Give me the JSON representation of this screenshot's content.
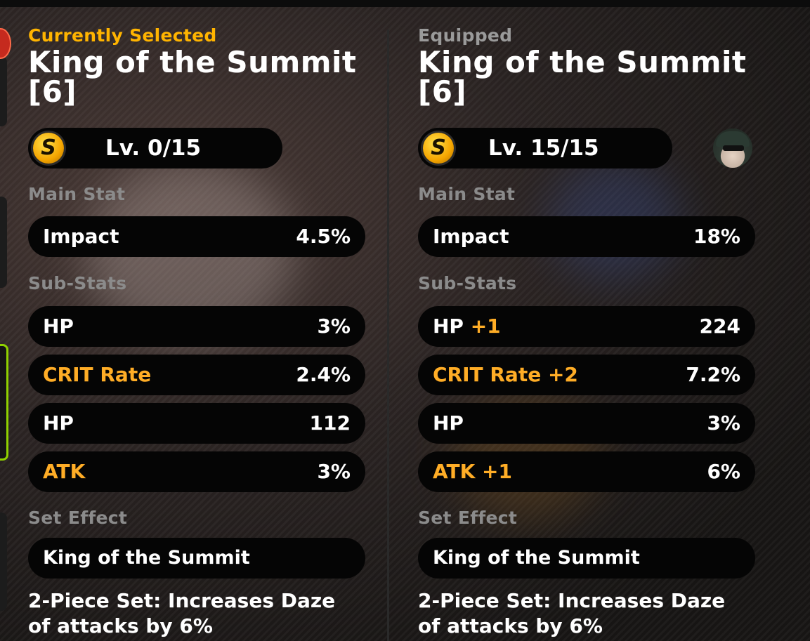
{
  "current": {
    "header": "Currently Selected",
    "name_line1": "King of the Summit",
    "name_line2": "[6]",
    "level": "Lv. 0/15",
    "rank_icon": "S",
    "main_stat_title": "Main Stat",
    "main_stat": {
      "name": "Impact",
      "value": "4.5%"
    },
    "sub_stats_title": "Sub-Stats",
    "sub_stats": [
      {
        "name": "HP",
        "boost": "",
        "value": "3%"
      },
      {
        "name": "CRIT Rate",
        "boost": "",
        "value": "2.4%"
      },
      {
        "name": "HP",
        "boost": "",
        "value": "112"
      },
      {
        "name": "ATK",
        "boost": "",
        "value": "3%"
      }
    ],
    "set_effect_title": "Set Effect",
    "set_name": "King of the Summit",
    "set_desc_line1": "2-Piece Set: Increases Daze",
    "set_desc_line2": "of attacks by 6%"
  },
  "equipped": {
    "header": "Equipped",
    "name_line1": "King of the Summit",
    "name_line2": "[6]",
    "level": "Lv. 15/15",
    "rank_icon": "S",
    "main_stat_title": "Main Stat",
    "main_stat": {
      "name": "Impact",
      "value": "18%"
    },
    "sub_stats_title": "Sub-Stats",
    "sub_stats": [
      {
        "name": "HP",
        "boost": "+1",
        "value": "224"
      },
      {
        "name": "CRIT Rate +2",
        "boost": "",
        "value": "7.2%"
      },
      {
        "name": "HP",
        "boost": "",
        "value": "3%"
      },
      {
        "name": "ATK +1",
        "boost": "",
        "value": "6%"
      }
    ],
    "set_effect_title": "Set Effect",
    "set_name": "King of the Summit",
    "set_desc_line1": "2-Piece Set: Increases Daze",
    "set_desc_line2": "of attacks by 6%"
  },
  "colors": {
    "accent_orange": "#ffad26",
    "header_yellow": "#ffb400",
    "muted_gray": "#8b8b8b",
    "pill_black": "#050505",
    "selection_green": "#8fd100"
  }
}
